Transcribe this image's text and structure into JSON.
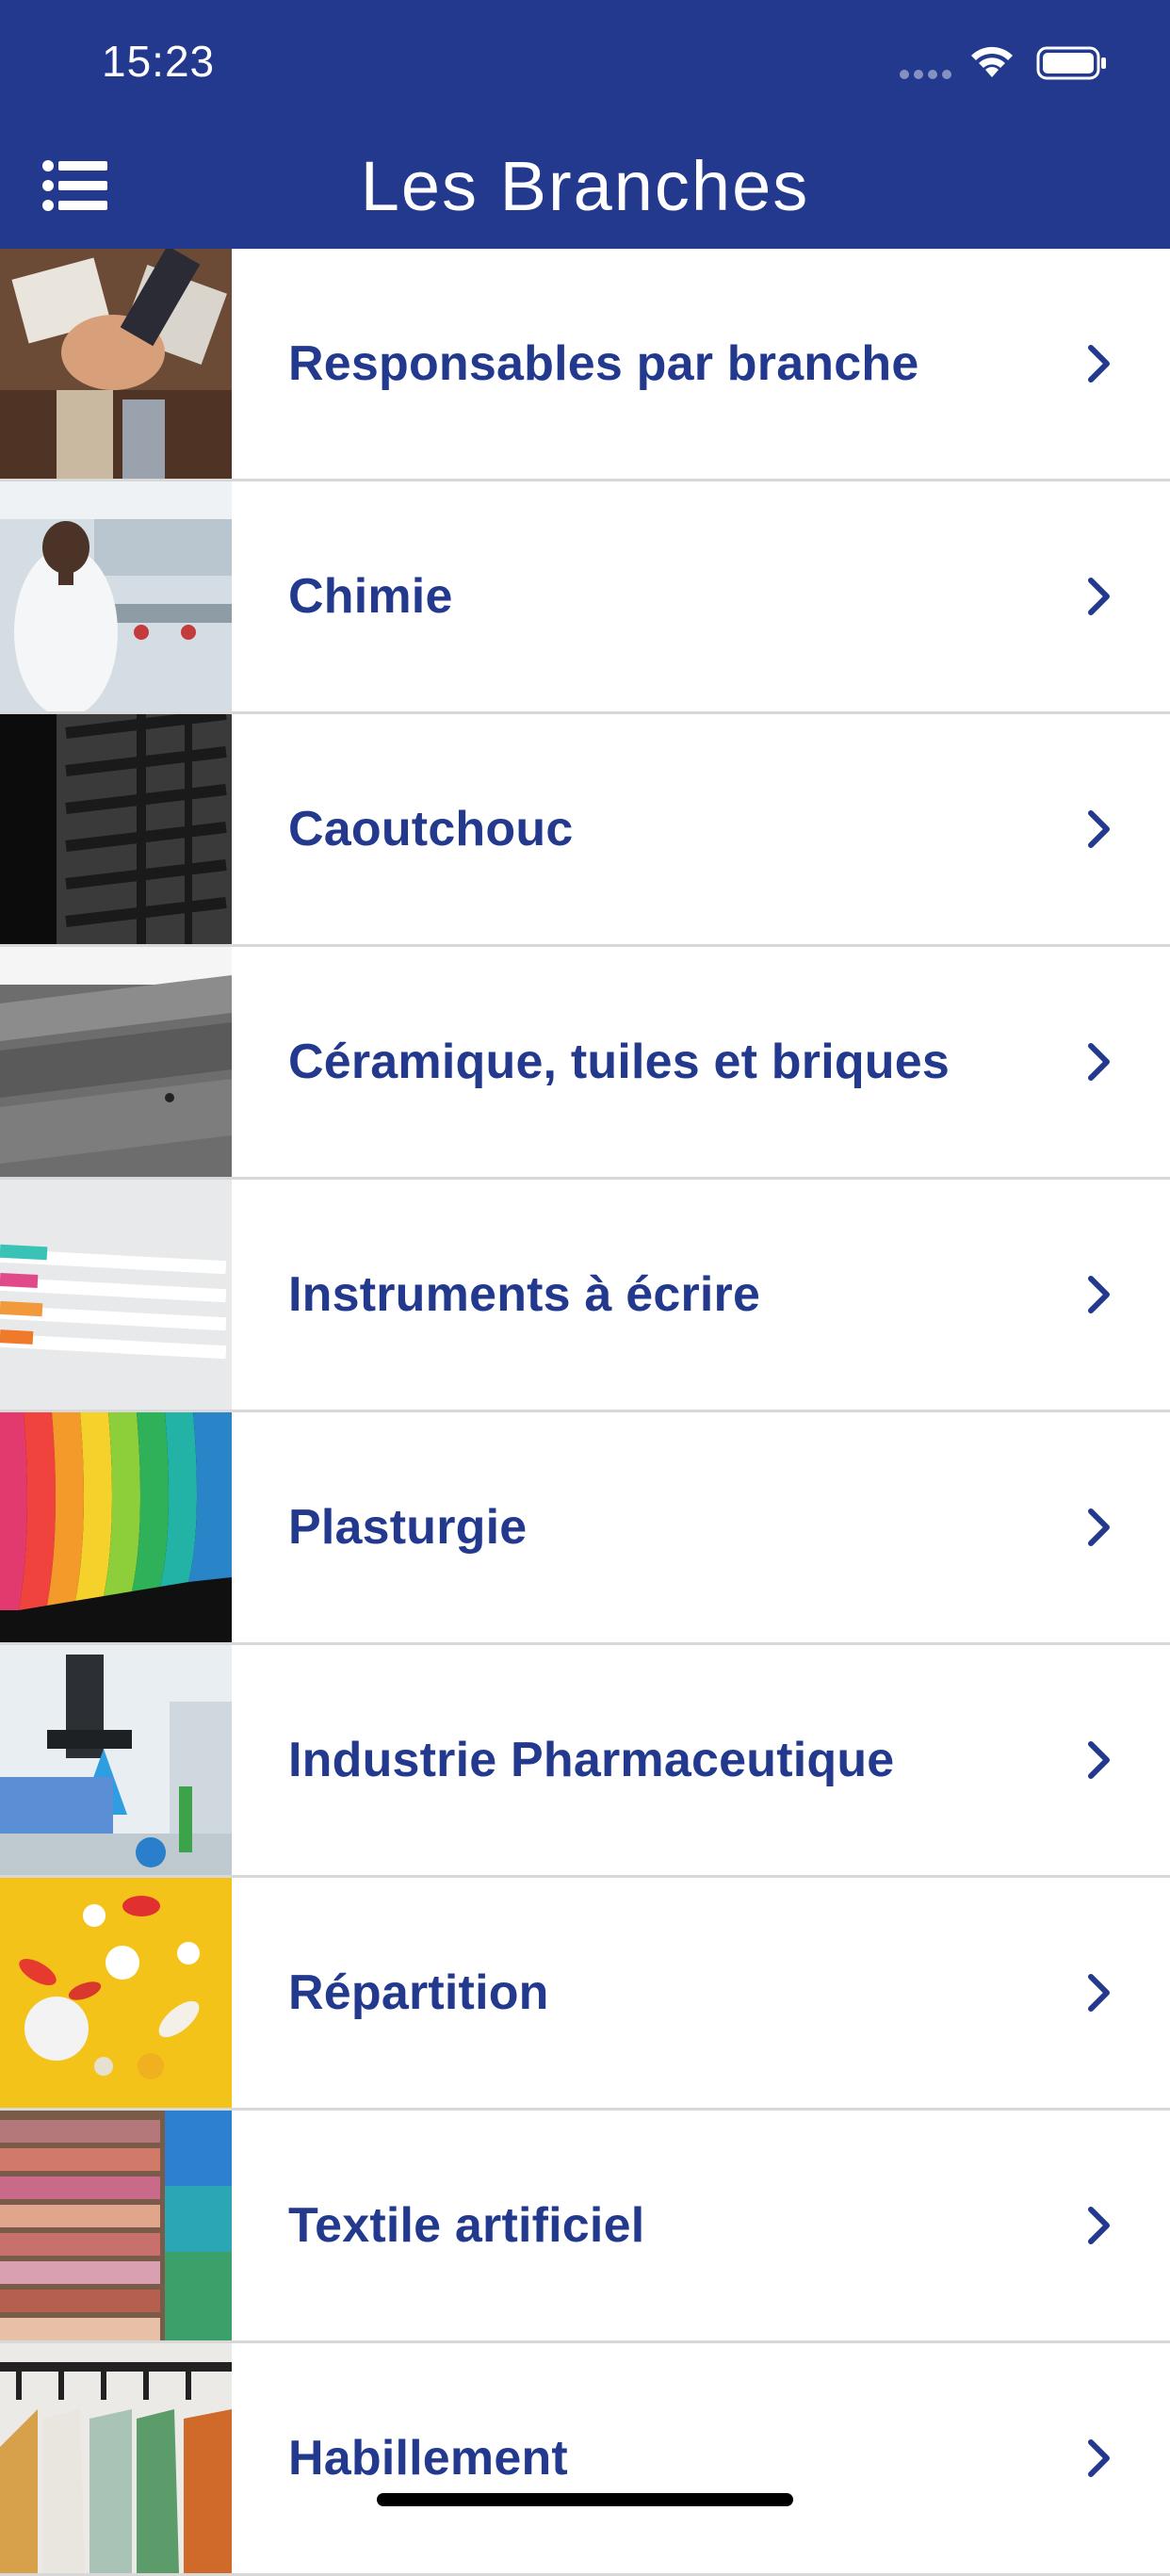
{
  "status_bar": {
    "time": "15:23",
    "icons": [
      "cellular-signal-icon",
      "wifi-icon",
      "battery-icon"
    ]
  },
  "nav_bar": {
    "title": "Les Branches",
    "menu_icon": "hamburger-menu-icon"
  },
  "colors": {
    "brand_blue": "#22398e",
    "separator": "#d8d8d8",
    "background": "#ffffff"
  },
  "branches": [
    {
      "label": "Responsables par branche",
      "image": "team-hands-photo"
    },
    {
      "label": "Chimie",
      "image": "laboratory-photo"
    },
    {
      "label": "Caoutchouc",
      "image": "tire-tread-photo"
    },
    {
      "label": "Céramique, tuiles et briques",
      "image": "roof-tiles-photo"
    },
    {
      "label": "Instruments à écrire",
      "image": "pens-photo"
    },
    {
      "label": "Plasturgie",
      "image": "colored-plastic-photo"
    },
    {
      "label": "Industrie Pharmaceutique",
      "image": "pharma-lab-photo"
    },
    {
      "label": "Répartition",
      "image": "pills-photo"
    },
    {
      "label": "Textile artificiel",
      "image": "folded-fabrics-photo"
    },
    {
      "label": "Habillement",
      "image": "clothes-hangers-photo"
    }
  ],
  "chevron_icon": "chevron-right-icon"
}
